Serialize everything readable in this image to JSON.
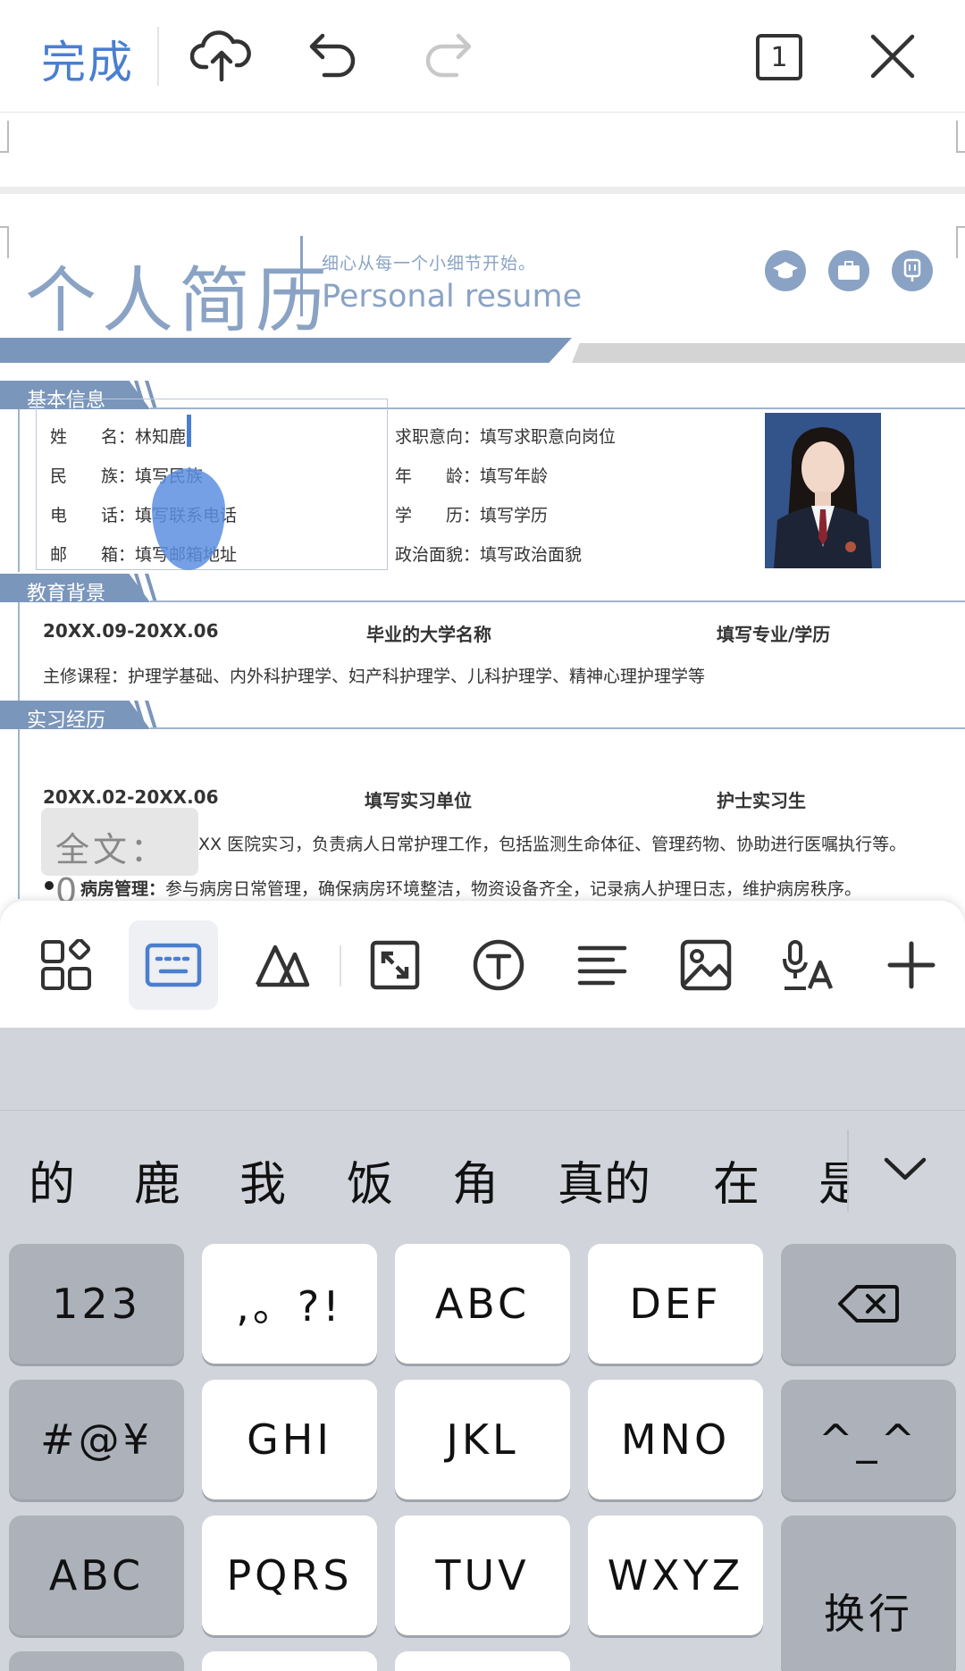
{
  "topbar": {
    "done_label": "完成",
    "page_count": "1",
    "icons": [
      "cloud-upload-icon",
      "undo-icon",
      "redo-icon",
      "page-count-icon",
      "close-icon"
    ]
  },
  "resume": {
    "title_cn": "个人简历",
    "subtitle_cn": "细心从每一个小细节开始。",
    "subtitle_en": "Personal resume",
    "header_icons": [
      "graduation-cap-icon",
      "briefcase-icon",
      "badge-icon"
    ],
    "sections": {
      "basic": "基本信息",
      "education": "教育背景",
      "internship": "实习经历"
    },
    "basic_left": [
      {
        "label": "姓　　名：",
        "value": "林知鹿"
      },
      {
        "label": "民　　族：",
        "value": "填写民族"
      },
      {
        "label": "电　　话：",
        "value": "填写联系电话"
      },
      {
        "label": "邮　　箱：",
        "value": "填写邮箱地址"
      }
    ],
    "basic_right": [
      {
        "label": "求职意向：",
        "value": "填写求职意向岗位"
      },
      {
        "label": "年　　龄：",
        "value": "填写年龄"
      },
      {
        "label": "学　　历：",
        "value": "填写学历"
      },
      {
        "label": "政治面貌：",
        "value": "填写政治面貌"
      }
    ],
    "education": {
      "period": "20XX.09-20XX.06",
      "school": "毕业的大学名称",
      "major": "填写专业/学历",
      "courses": "主修课程：护理学基础、内外科护理学、妇产科护理学、儿科护理学、精神心理护理学等"
    },
    "internship": {
      "period": "20XX.02-20XX.06",
      "unit": "填写实习单位",
      "role": "护士实习生",
      "line1": "XX 医院实习，负责病人日常护理工作，包括监测生命体征、管理药物、协助进行医嘱执行等。",
      "bullet_label": "病房管理：",
      "bullet_text": "参与病房日常管理，确保病房环境整洁，物资设备齐全，记录病人护理日志，维护病房秩序。"
    }
  },
  "word_counter": "全文：　0",
  "edit_toolbar": {
    "icons": [
      "layout-grid-icon",
      "keyboard-icon",
      "text-style-icon",
      "fullscreen-icon",
      "text-circle-icon",
      "align-icon",
      "image-icon",
      "voice-to-text-icon",
      "plus-icon"
    ]
  },
  "keyboard": {
    "candidates": [
      "的",
      "鹿",
      "我",
      "饭",
      "角",
      "真的",
      "在",
      "是"
    ],
    "keys": {
      "row1": [
        "123",
        ",。?!",
        "ABC",
        "DEF"
      ],
      "row2": [
        "#@¥",
        "GHI",
        "JKL",
        "MNO",
        "^_^"
      ],
      "row3": [
        "ABC",
        "PQRS",
        "TUV",
        "WXYZ"
      ],
      "return": "换行"
    },
    "accent_color": "#4a7fd0"
  }
}
